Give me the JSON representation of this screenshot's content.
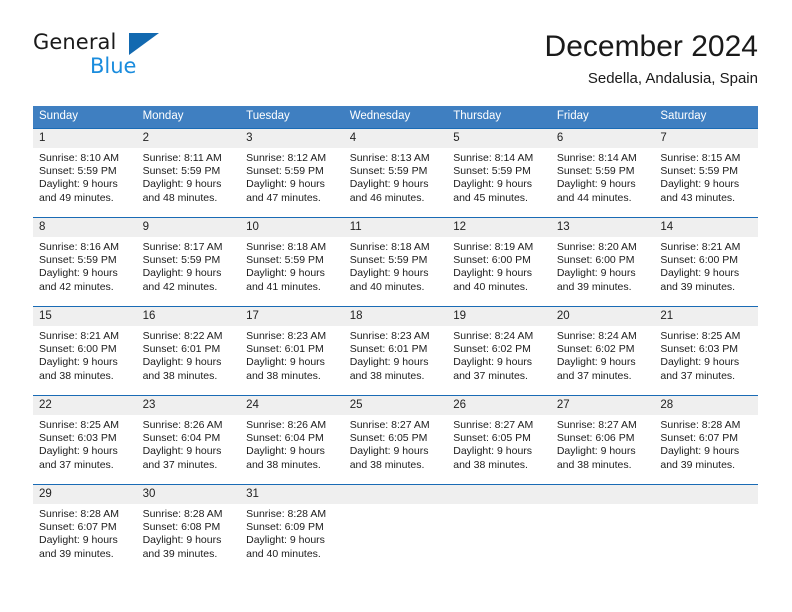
{
  "brand": {
    "name_top": "General",
    "name_bottom": "Blue",
    "accent_color": "#1a8cdd",
    "triangle_color": "#1269b0"
  },
  "header": {
    "title": "December 2024",
    "subtitle": "Sedella, Andalusia, Spain"
  },
  "calendar": {
    "header_bg": "#3f7fc1",
    "daynum_bg": "#efefef",
    "row_border_color": "#1a6bb5",
    "weekday_headers": [
      "Sunday",
      "Monday",
      "Tuesday",
      "Wednesday",
      "Thursday",
      "Friday",
      "Saturday"
    ],
    "weeks": [
      [
        {
          "day": "1",
          "sunrise": "Sunrise: 8:10 AM",
          "sunset": "Sunset: 5:59 PM",
          "daylight_line1": "Daylight: 9 hours",
          "daylight_line2": "and 49 minutes."
        },
        {
          "day": "2",
          "sunrise": "Sunrise: 8:11 AM",
          "sunset": "Sunset: 5:59 PM",
          "daylight_line1": "Daylight: 9 hours",
          "daylight_line2": "and 48 minutes."
        },
        {
          "day": "3",
          "sunrise": "Sunrise: 8:12 AM",
          "sunset": "Sunset: 5:59 PM",
          "daylight_line1": "Daylight: 9 hours",
          "daylight_line2": "and 47 minutes."
        },
        {
          "day": "4",
          "sunrise": "Sunrise: 8:13 AM",
          "sunset": "Sunset: 5:59 PM",
          "daylight_line1": "Daylight: 9 hours",
          "daylight_line2": "and 46 minutes."
        },
        {
          "day": "5",
          "sunrise": "Sunrise: 8:14 AM",
          "sunset": "Sunset: 5:59 PM",
          "daylight_line1": "Daylight: 9 hours",
          "daylight_line2": "and 45 minutes."
        },
        {
          "day": "6",
          "sunrise": "Sunrise: 8:14 AM",
          "sunset": "Sunset: 5:59 PM",
          "daylight_line1": "Daylight: 9 hours",
          "daylight_line2": "and 44 minutes."
        },
        {
          "day": "7",
          "sunrise": "Sunrise: 8:15 AM",
          "sunset": "Sunset: 5:59 PM",
          "daylight_line1": "Daylight: 9 hours",
          "daylight_line2": "and 43 minutes."
        }
      ],
      [
        {
          "day": "8",
          "sunrise": "Sunrise: 8:16 AM",
          "sunset": "Sunset: 5:59 PM",
          "daylight_line1": "Daylight: 9 hours",
          "daylight_line2": "and 42 minutes."
        },
        {
          "day": "9",
          "sunrise": "Sunrise: 8:17 AM",
          "sunset": "Sunset: 5:59 PM",
          "daylight_line1": "Daylight: 9 hours",
          "daylight_line2": "and 42 minutes."
        },
        {
          "day": "10",
          "sunrise": "Sunrise: 8:18 AM",
          "sunset": "Sunset: 5:59 PM",
          "daylight_line1": "Daylight: 9 hours",
          "daylight_line2": "and 41 minutes."
        },
        {
          "day": "11",
          "sunrise": "Sunrise: 8:18 AM",
          "sunset": "Sunset: 5:59 PM",
          "daylight_line1": "Daylight: 9 hours",
          "daylight_line2": "and 40 minutes."
        },
        {
          "day": "12",
          "sunrise": "Sunrise: 8:19 AM",
          "sunset": "Sunset: 6:00 PM",
          "daylight_line1": "Daylight: 9 hours",
          "daylight_line2": "and 40 minutes."
        },
        {
          "day": "13",
          "sunrise": "Sunrise: 8:20 AM",
          "sunset": "Sunset: 6:00 PM",
          "daylight_line1": "Daylight: 9 hours",
          "daylight_line2": "and 39 minutes."
        },
        {
          "day": "14",
          "sunrise": "Sunrise: 8:21 AM",
          "sunset": "Sunset: 6:00 PM",
          "daylight_line1": "Daylight: 9 hours",
          "daylight_line2": "and 39 minutes."
        }
      ],
      [
        {
          "day": "15",
          "sunrise": "Sunrise: 8:21 AM",
          "sunset": "Sunset: 6:00 PM",
          "daylight_line1": "Daylight: 9 hours",
          "daylight_line2": "and 38 minutes."
        },
        {
          "day": "16",
          "sunrise": "Sunrise: 8:22 AM",
          "sunset": "Sunset: 6:01 PM",
          "daylight_line1": "Daylight: 9 hours",
          "daylight_line2": "and 38 minutes."
        },
        {
          "day": "17",
          "sunrise": "Sunrise: 8:23 AM",
          "sunset": "Sunset: 6:01 PM",
          "daylight_line1": "Daylight: 9 hours",
          "daylight_line2": "and 38 minutes."
        },
        {
          "day": "18",
          "sunrise": "Sunrise: 8:23 AM",
          "sunset": "Sunset: 6:01 PM",
          "daylight_line1": "Daylight: 9 hours",
          "daylight_line2": "and 38 minutes."
        },
        {
          "day": "19",
          "sunrise": "Sunrise: 8:24 AM",
          "sunset": "Sunset: 6:02 PM",
          "daylight_line1": "Daylight: 9 hours",
          "daylight_line2": "and 37 minutes."
        },
        {
          "day": "20",
          "sunrise": "Sunrise: 8:24 AM",
          "sunset": "Sunset: 6:02 PM",
          "daylight_line1": "Daylight: 9 hours",
          "daylight_line2": "and 37 minutes."
        },
        {
          "day": "21",
          "sunrise": "Sunrise: 8:25 AM",
          "sunset": "Sunset: 6:03 PM",
          "daylight_line1": "Daylight: 9 hours",
          "daylight_line2": "and 37 minutes."
        }
      ],
      [
        {
          "day": "22",
          "sunrise": "Sunrise: 8:25 AM",
          "sunset": "Sunset: 6:03 PM",
          "daylight_line1": "Daylight: 9 hours",
          "daylight_line2": "and 37 minutes."
        },
        {
          "day": "23",
          "sunrise": "Sunrise: 8:26 AM",
          "sunset": "Sunset: 6:04 PM",
          "daylight_line1": "Daylight: 9 hours",
          "daylight_line2": "and 37 minutes."
        },
        {
          "day": "24",
          "sunrise": "Sunrise: 8:26 AM",
          "sunset": "Sunset: 6:04 PM",
          "daylight_line1": "Daylight: 9 hours",
          "daylight_line2": "and 38 minutes."
        },
        {
          "day": "25",
          "sunrise": "Sunrise: 8:27 AM",
          "sunset": "Sunset: 6:05 PM",
          "daylight_line1": "Daylight: 9 hours",
          "daylight_line2": "and 38 minutes."
        },
        {
          "day": "26",
          "sunrise": "Sunrise: 8:27 AM",
          "sunset": "Sunset: 6:05 PM",
          "daylight_line1": "Daylight: 9 hours",
          "daylight_line2": "and 38 minutes."
        },
        {
          "day": "27",
          "sunrise": "Sunrise: 8:27 AM",
          "sunset": "Sunset: 6:06 PM",
          "daylight_line1": "Daylight: 9 hours",
          "daylight_line2": "and 38 minutes."
        },
        {
          "day": "28",
          "sunrise": "Sunrise: 8:28 AM",
          "sunset": "Sunset: 6:07 PM",
          "daylight_line1": "Daylight: 9 hours",
          "daylight_line2": "and 39 minutes."
        }
      ],
      [
        {
          "day": "29",
          "sunrise": "Sunrise: 8:28 AM",
          "sunset": "Sunset: 6:07 PM",
          "daylight_line1": "Daylight: 9 hours",
          "daylight_line2": "and 39 minutes."
        },
        {
          "day": "30",
          "sunrise": "Sunrise: 8:28 AM",
          "sunset": "Sunset: 6:08 PM",
          "daylight_line1": "Daylight: 9 hours",
          "daylight_line2": "and 39 minutes."
        },
        {
          "day": "31",
          "sunrise": "Sunrise: 8:28 AM",
          "sunset": "Sunset: 6:09 PM",
          "daylight_line1": "Daylight: 9 hours",
          "daylight_line2": "and 40 minutes."
        },
        {
          "day": "",
          "sunrise": "",
          "sunset": "",
          "daylight_line1": "",
          "daylight_line2": ""
        },
        {
          "day": "",
          "sunrise": "",
          "sunset": "",
          "daylight_line1": "",
          "daylight_line2": ""
        },
        {
          "day": "",
          "sunrise": "",
          "sunset": "",
          "daylight_line1": "",
          "daylight_line2": ""
        },
        {
          "day": "",
          "sunrise": "",
          "sunset": "",
          "daylight_line1": "",
          "daylight_line2": ""
        }
      ]
    ]
  }
}
